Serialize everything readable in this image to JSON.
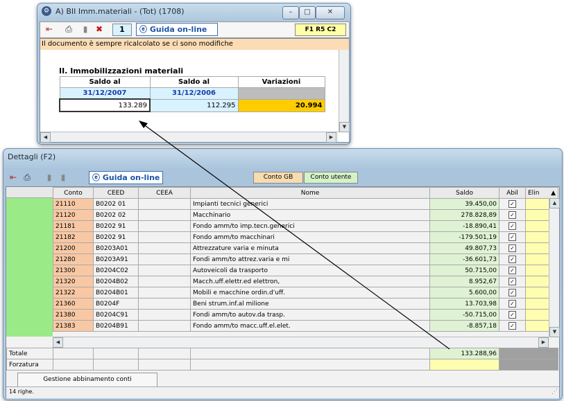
{
  "top_window": {
    "title": "A) BII Imm.materiali - (Tot) (1708)",
    "page_number": "1",
    "guida_label": "Guida on-line",
    "position_label": "F1 R5 C2",
    "notice": "Il documento è sempre ricalcolato se ci sono modifiche",
    "section_title": "II. Immobilizzazioni materiali",
    "columns": [
      "Saldo al",
      "Saldo al",
      "Variazioni"
    ],
    "dates": [
      "31/12/2007",
      "31/12/2006"
    ],
    "values": [
      "133.289",
      "112.295",
      "20.994"
    ]
  },
  "bottom_window": {
    "title": "Dettagli (F2)",
    "guida_label": "Guida on-line",
    "conto_gb_label": "Conto GB",
    "conto_utente_label": "Conto utente",
    "columns": [
      "Conto",
      "CEED",
      "CEEA",
      "Nome",
      "Saldo",
      "Abil",
      "Elin"
    ],
    "rows": [
      {
        "conto": "21110",
        "ceed": "B0202 01",
        "ceea": "",
        "nome": "Impianti tecnici generici",
        "saldo": "39.450,00",
        "abil": "✓"
      },
      {
        "conto": "21120",
        "ceed": "B0202 02",
        "ceea": "",
        "nome": "Macchinario",
        "saldo": "278.828,89",
        "abil": "✓"
      },
      {
        "conto": "21181",
        "ceed": "B0202 91",
        "ceea": "",
        "nome": "Fondo amm/to imp.tecn.generici",
        "saldo": "-18.890,41",
        "abil": "✓"
      },
      {
        "conto": "21182",
        "ceed": "B0202 91",
        "ceea": "",
        "nome": "Fondo amm/to macchinari",
        "saldo": "-179.501,19",
        "abil": "✓"
      },
      {
        "conto": "21200",
        "ceed": "B0203A01",
        "ceea": "",
        "nome": "Attrezzature varia e minuta",
        "saldo": "49.807,73",
        "abil": "✓"
      },
      {
        "conto": "21280",
        "ceed": "B0203A91",
        "ceea": "",
        "nome": "Fondi amm/to attrez.varia e mi",
        "saldo": "-36.601,73",
        "abil": "✓"
      },
      {
        "conto": "21300",
        "ceed": "B0204C02",
        "ceea": "",
        "nome": "Autoveicoli da trasporto",
        "saldo": "50.715,00",
        "abil": "✓"
      },
      {
        "conto": "21320",
        "ceed": "B0204B02",
        "ceea": "",
        "nome": "Macch.uff.elettr.ed elettron,",
        "saldo": "8.952,67",
        "abil": "✓"
      },
      {
        "conto": "21322",
        "ceed": "B0204B01",
        "ceea": "",
        "nome": "Mobili e macchine ordin.d'uff.",
        "saldo": "5.600,00",
        "abil": "✓"
      },
      {
        "conto": "21360",
        "ceed": "B0204F",
        "ceea": "",
        "nome": "Beni strum.inf.al milione",
        "saldo": "13.703,98",
        "abil": "✓"
      },
      {
        "conto": "21380",
        "ceed": "B0204C91",
        "ceea": "",
        "nome": "Fondi amm/to autov.da trasp.",
        "saldo": "-50.715,00",
        "abil": "✓"
      },
      {
        "conto": "21383",
        "ceed": "B0204B91",
        "ceea": "",
        "nome": "Fondo amm/to macc.uff.el.elet.",
        "saldo": "-8.857,18",
        "abil": "✓"
      }
    ],
    "totale_label": "Totale",
    "totale_value": "133.288,96",
    "forzatura_label": "Forzatura",
    "gestione_tab": "Gestione abbinamento conti",
    "status": "14 righe."
  },
  "colors": {
    "notice_bg": "#fcdcb4",
    "date_bg": "#d8f2ff",
    "variation_bg": "#ffcc00",
    "conto_bg": "#f8c8a4",
    "saldo_bg": "#dff2d4",
    "elim_bg": "#fffdb0",
    "total_bg": "#dff2d4",
    "forzatura_bg": "#fffdb0",
    "left_strip": "#9aea88"
  }
}
